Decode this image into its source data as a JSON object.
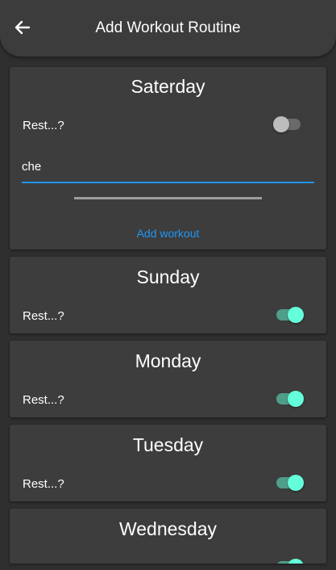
{
  "appbar": {
    "title": "Add Workout Routine",
    "back_icon": "arrow-left-icon"
  },
  "colors": {
    "background": "#2f2f2f",
    "card": "#3d3d3d",
    "accent_blue": "#2196f3",
    "toggle_on": "#64ffda"
  },
  "days": [
    {
      "name": "Saterday",
      "rest_label": "Rest...?",
      "rest_on": false,
      "input_value": "che",
      "add_label": "Add workout"
    },
    {
      "name": "Sunday",
      "rest_label": "Rest...?",
      "rest_on": true
    },
    {
      "name": "Monday",
      "rest_label": "Rest...?",
      "rest_on": true
    },
    {
      "name": "Tuesday",
      "rest_label": "Rest...?",
      "rest_on": true
    },
    {
      "name": "Wednesday",
      "rest_on": true
    }
  ]
}
